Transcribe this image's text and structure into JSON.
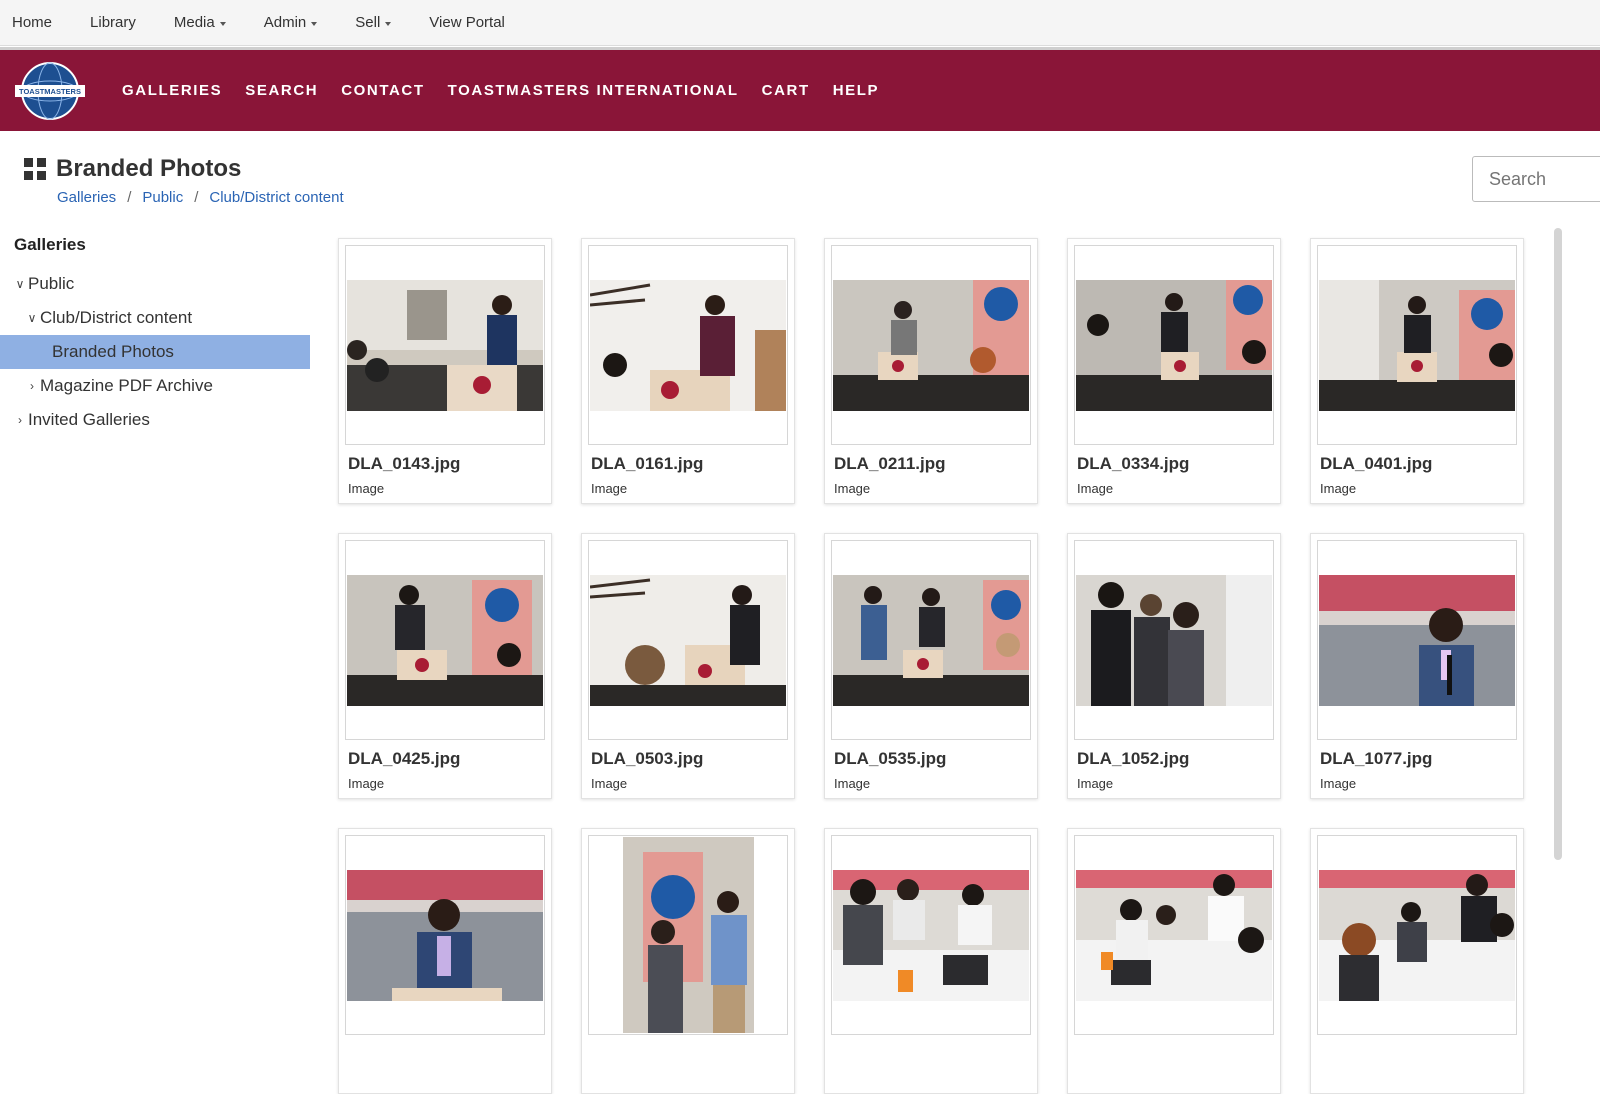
{
  "admin_bar": {
    "items": [
      {
        "label": "Home",
        "dropdown": false
      },
      {
        "label": "Library",
        "dropdown": false
      },
      {
        "label": "Media",
        "dropdown": true
      },
      {
        "label": "Admin",
        "dropdown": true
      },
      {
        "label": "Sell",
        "dropdown": true
      },
      {
        "label": "View Portal",
        "dropdown": false
      }
    ]
  },
  "brand": {
    "logo_text": "TOASTMASTERS",
    "color": "#8a1538",
    "nav": [
      "GALLERIES",
      "SEARCH",
      "CONTACT",
      "TOASTMASTERS INTERNATIONAL",
      "CART",
      "HELP"
    ]
  },
  "header": {
    "title": "Branded Photos",
    "breadcrumb": [
      "Galleries",
      "Public",
      "Club/District content"
    ],
    "search_placeholder": "Search"
  },
  "sidebar": {
    "heading": "Galleries",
    "tree": [
      {
        "label": "Public",
        "expanded": true,
        "selected": false
      },
      {
        "label": "Club/District content",
        "expanded": true,
        "selected": false
      },
      {
        "label": "Branded Photos",
        "expanded": false,
        "selected": true
      },
      {
        "label": "Magazine PDF Archive",
        "expanded": false,
        "selected": false
      },
      {
        "label": "Invited Galleries",
        "expanded": false,
        "selected": false
      }
    ],
    "selected_color": "#8fb0e3"
  },
  "gallery": {
    "items": [
      {
        "name": "DLA_0143.jpg",
        "type": "Image"
      },
      {
        "name": "DLA_0161.jpg",
        "type": "Image"
      },
      {
        "name": "DLA_0211.jpg",
        "type": "Image"
      },
      {
        "name": "DLA_0334.jpg",
        "type": "Image"
      },
      {
        "name": "DLA_0401.jpg",
        "type": "Image"
      },
      {
        "name": "DLA_0425.jpg",
        "type": "Image"
      },
      {
        "name": "DLA_0503.jpg",
        "type": "Image"
      },
      {
        "name": "DLA_0535.jpg",
        "type": "Image"
      },
      {
        "name": "DLA_1052.jpg",
        "type": "Image"
      },
      {
        "name": "DLA_1077.jpg",
        "type": "Image"
      },
      {
        "name": "",
        "type": ""
      },
      {
        "name": "",
        "type": ""
      },
      {
        "name": "",
        "type": ""
      },
      {
        "name": "",
        "type": ""
      },
      {
        "name": "",
        "type": ""
      }
    ]
  }
}
